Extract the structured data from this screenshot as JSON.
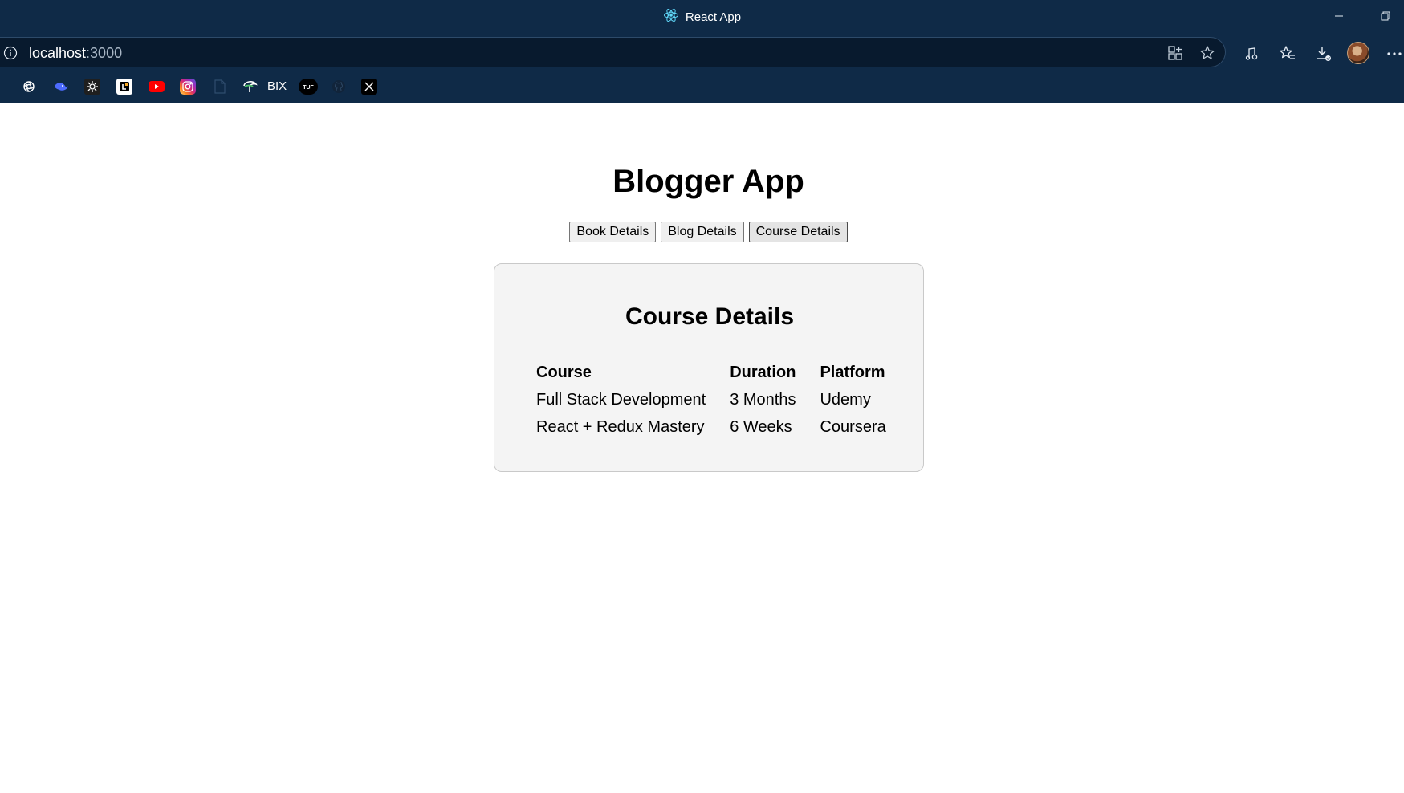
{
  "browser": {
    "tab_title": "React App",
    "url_host": "localhost",
    "url_port": ":3000",
    "accent": "#0f2a47",
    "bookmarks": [
      {
        "icon": "chatgpt-icon"
      },
      {
        "icon": "deepseek-icon"
      },
      {
        "icon": "app-icon"
      },
      {
        "icon": "codechef-icon"
      },
      {
        "icon": "youtube-icon"
      },
      {
        "icon": "instagram-icon"
      },
      {
        "icon": "document-icon"
      },
      {
        "icon": "bix-icon",
        "label": "BIX"
      },
      {
        "icon": "tuf-icon"
      },
      {
        "icon": "github-icon"
      },
      {
        "icon": "x-icon"
      }
    ]
  },
  "app": {
    "title": "Blogger App",
    "buttons": {
      "book": "Book Details",
      "blog": "Blog Details",
      "course": "Course Details"
    },
    "active_section": "Course Details",
    "course_card": {
      "title": "Course Details",
      "headers": [
        "Course",
        "Duration",
        "Platform"
      ],
      "rows": [
        [
          "Full Stack Development",
          "3 Months",
          "Udemy"
        ],
        [
          "React + Redux Mastery",
          "6 Weeks",
          "Coursera"
        ]
      ]
    }
  }
}
